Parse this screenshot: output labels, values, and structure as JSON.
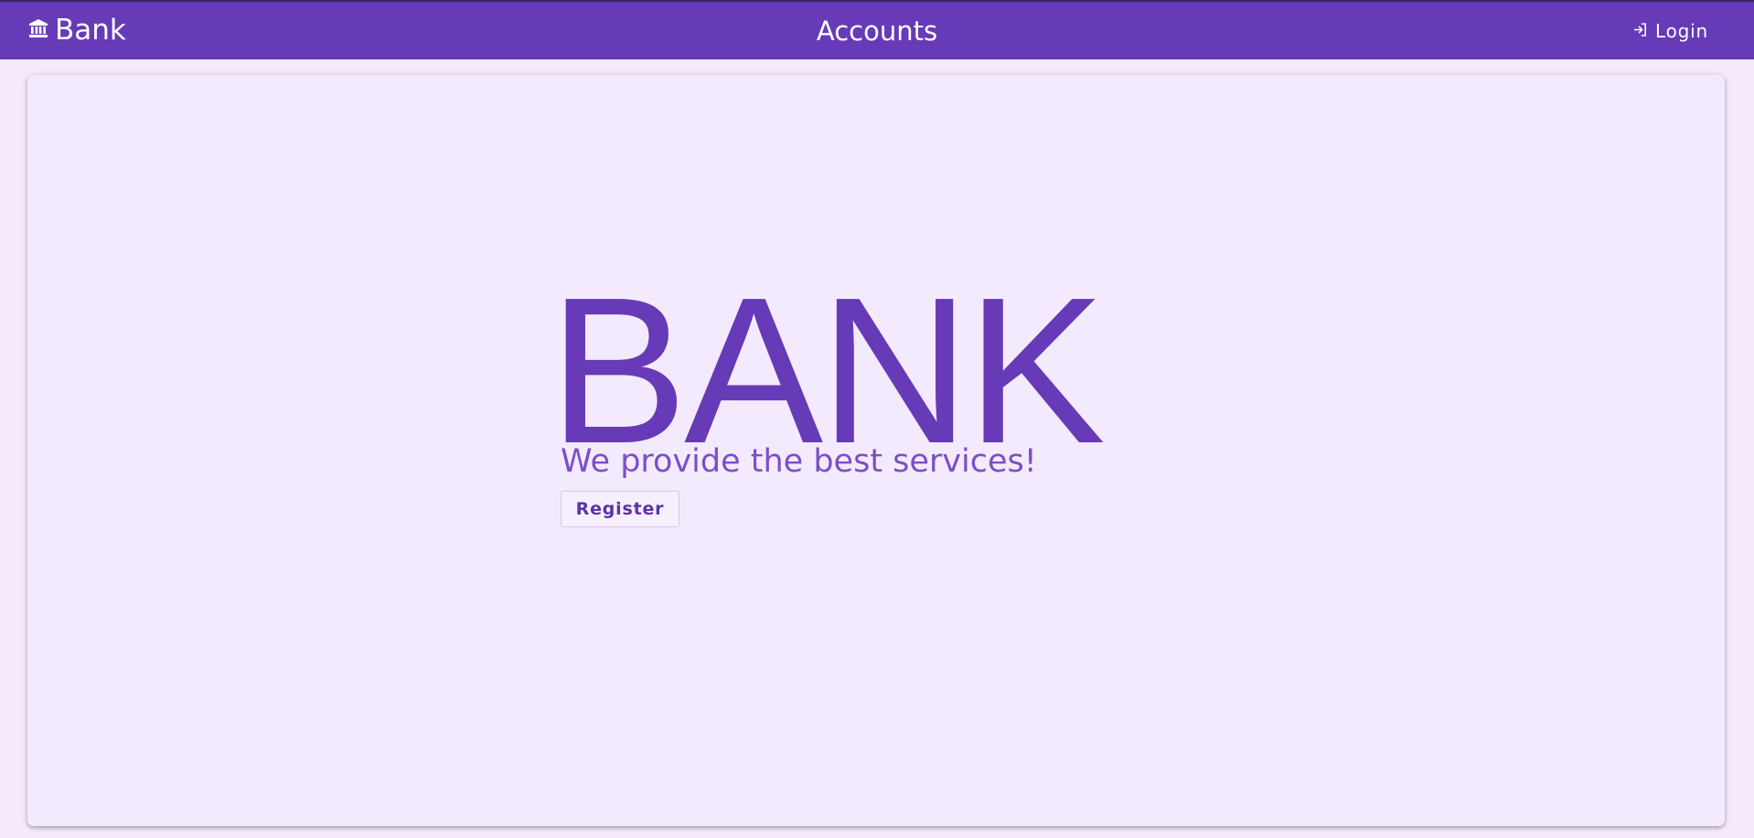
{
  "header": {
    "brand_label": "Bank",
    "brand_icon": "bank-icon",
    "title": "Accounts",
    "login_label": "Login",
    "login_icon": "login-icon"
  },
  "hero": {
    "title": "BANK",
    "subtitle": "We provide the best services!",
    "register_label": "Register"
  },
  "colors": {
    "primary": "#673ab7",
    "background": "#f4eafb",
    "card": "#f4eafd"
  }
}
